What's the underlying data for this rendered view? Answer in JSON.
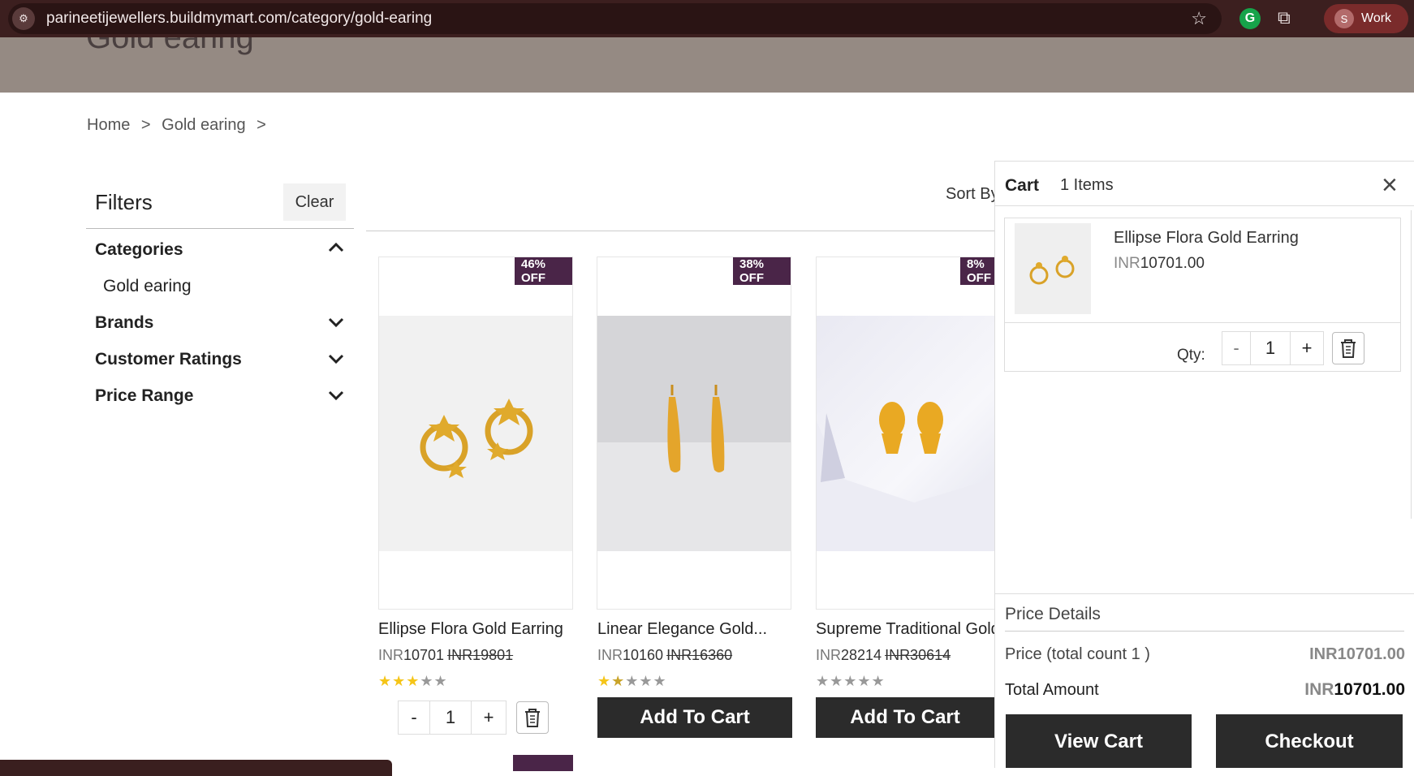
{
  "browser": {
    "url": "parineetijewellers.buildmymart.com/category/gold-earing",
    "profile_initial": "S",
    "profile_name": "Work",
    "extension_initial": "G"
  },
  "page": {
    "banner_title": "Gold earing",
    "breadcrumb": [
      "Home",
      ">",
      "Gold earing",
      ">"
    ]
  },
  "filters": {
    "title": "Filters",
    "clear_label": "Clear",
    "sections": [
      {
        "label": "Categories",
        "expanded": true,
        "items": [
          "Gold earing"
        ]
      },
      {
        "label": "Brands",
        "expanded": false
      },
      {
        "label": "Customer Ratings",
        "expanded": false
      },
      {
        "label": "Price Range",
        "expanded": false
      }
    ]
  },
  "sort": {
    "label": "Sort By"
  },
  "products": [
    {
      "badge": "46% OFF",
      "name": "Ellipse Flora Gold Earring",
      "currency": "INR",
      "price": "10701",
      "mrp": "INR19801",
      "rating": 3,
      "in_cart": true,
      "qty": "1",
      "minus": "-",
      "plus": "+"
    },
    {
      "badge": "38% OFF",
      "name": "Linear Elegance Gold...",
      "currency": "INR",
      "price": "10160",
      "mrp": "INR16360",
      "rating": 1.5,
      "in_cart": false,
      "button": "Add To Cart"
    },
    {
      "badge": "8% OFF",
      "name": "Supreme Traditional Gold Earring",
      "currency": "INR",
      "price": "28214",
      "mrp": "INR30614",
      "rating": 0,
      "in_cart": false,
      "button": "Add To Cart"
    }
  ],
  "cart": {
    "title": "Cart",
    "items_count": "1 Items",
    "item": {
      "name": "Ellipse Flora Gold Earring",
      "currency": "INR",
      "price": "10701.00",
      "qty_label": "Qty:",
      "qty": "1",
      "minus": "-",
      "plus": "+"
    },
    "price_details": {
      "title": "Price Details",
      "price_label": "Price (total count 1 )",
      "price_value": "INR10701.00",
      "total_label": "Total Amount",
      "total_currency": "INR",
      "total_value": "10701.00"
    },
    "view_cart_label": "View Cart",
    "checkout_label": "Checkout"
  },
  "colors": {
    "brand_dark": "#2b2b2b",
    "badge": "#4a2548",
    "banner": "#958a83",
    "star": "#f5c518"
  }
}
